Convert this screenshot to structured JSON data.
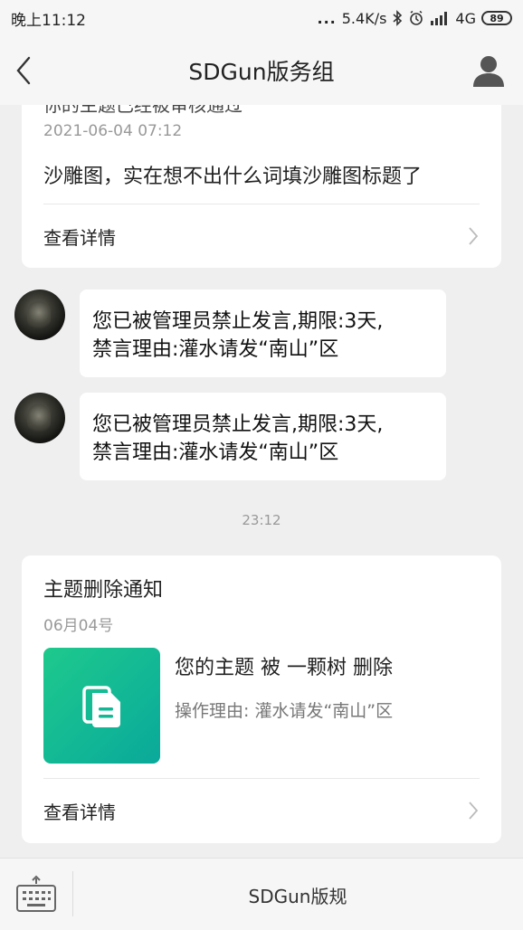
{
  "status_bar": {
    "time": "晚上11:12",
    "dots": "...",
    "net_speed": "5.4K/s",
    "network": "4G",
    "battery": "89"
  },
  "header": {
    "title": "SDGun版务组",
    "back_icon": "chevron-left-icon",
    "profile_icon": "person-icon"
  },
  "card1": {
    "clipped_title": "你的主题已经被审核通过",
    "date": "2021-06-04 07:12",
    "body": "沙雕图，实在想不出什么词填沙雕图标题了",
    "detail_label": "查看详情"
  },
  "messages": [
    {
      "line1": "您已被管理员禁止发言,期限:3天,",
      "line2": "禁言理由:灌水请发“南山”区"
    },
    {
      "line1": "您已被管理员禁止发言,期限:3天,",
      "line2": "禁言理由:灌水请发“南山”区"
    }
  ],
  "timestamp": "23:12",
  "card2": {
    "title": "主题删除通知",
    "date": "06月04号",
    "line1": "您的主题 被 一颗树 删除",
    "line2": "操作理由: 灌水请发“南山”区",
    "detail_label": "查看详情",
    "thumb_icon": "document-icon"
  },
  "bottom_bar": {
    "keyboard_icon": "keyboard-icon",
    "menu_label": "SDGun版规"
  },
  "colors": {
    "background": "#efefef",
    "accent_green": "#12b895"
  }
}
